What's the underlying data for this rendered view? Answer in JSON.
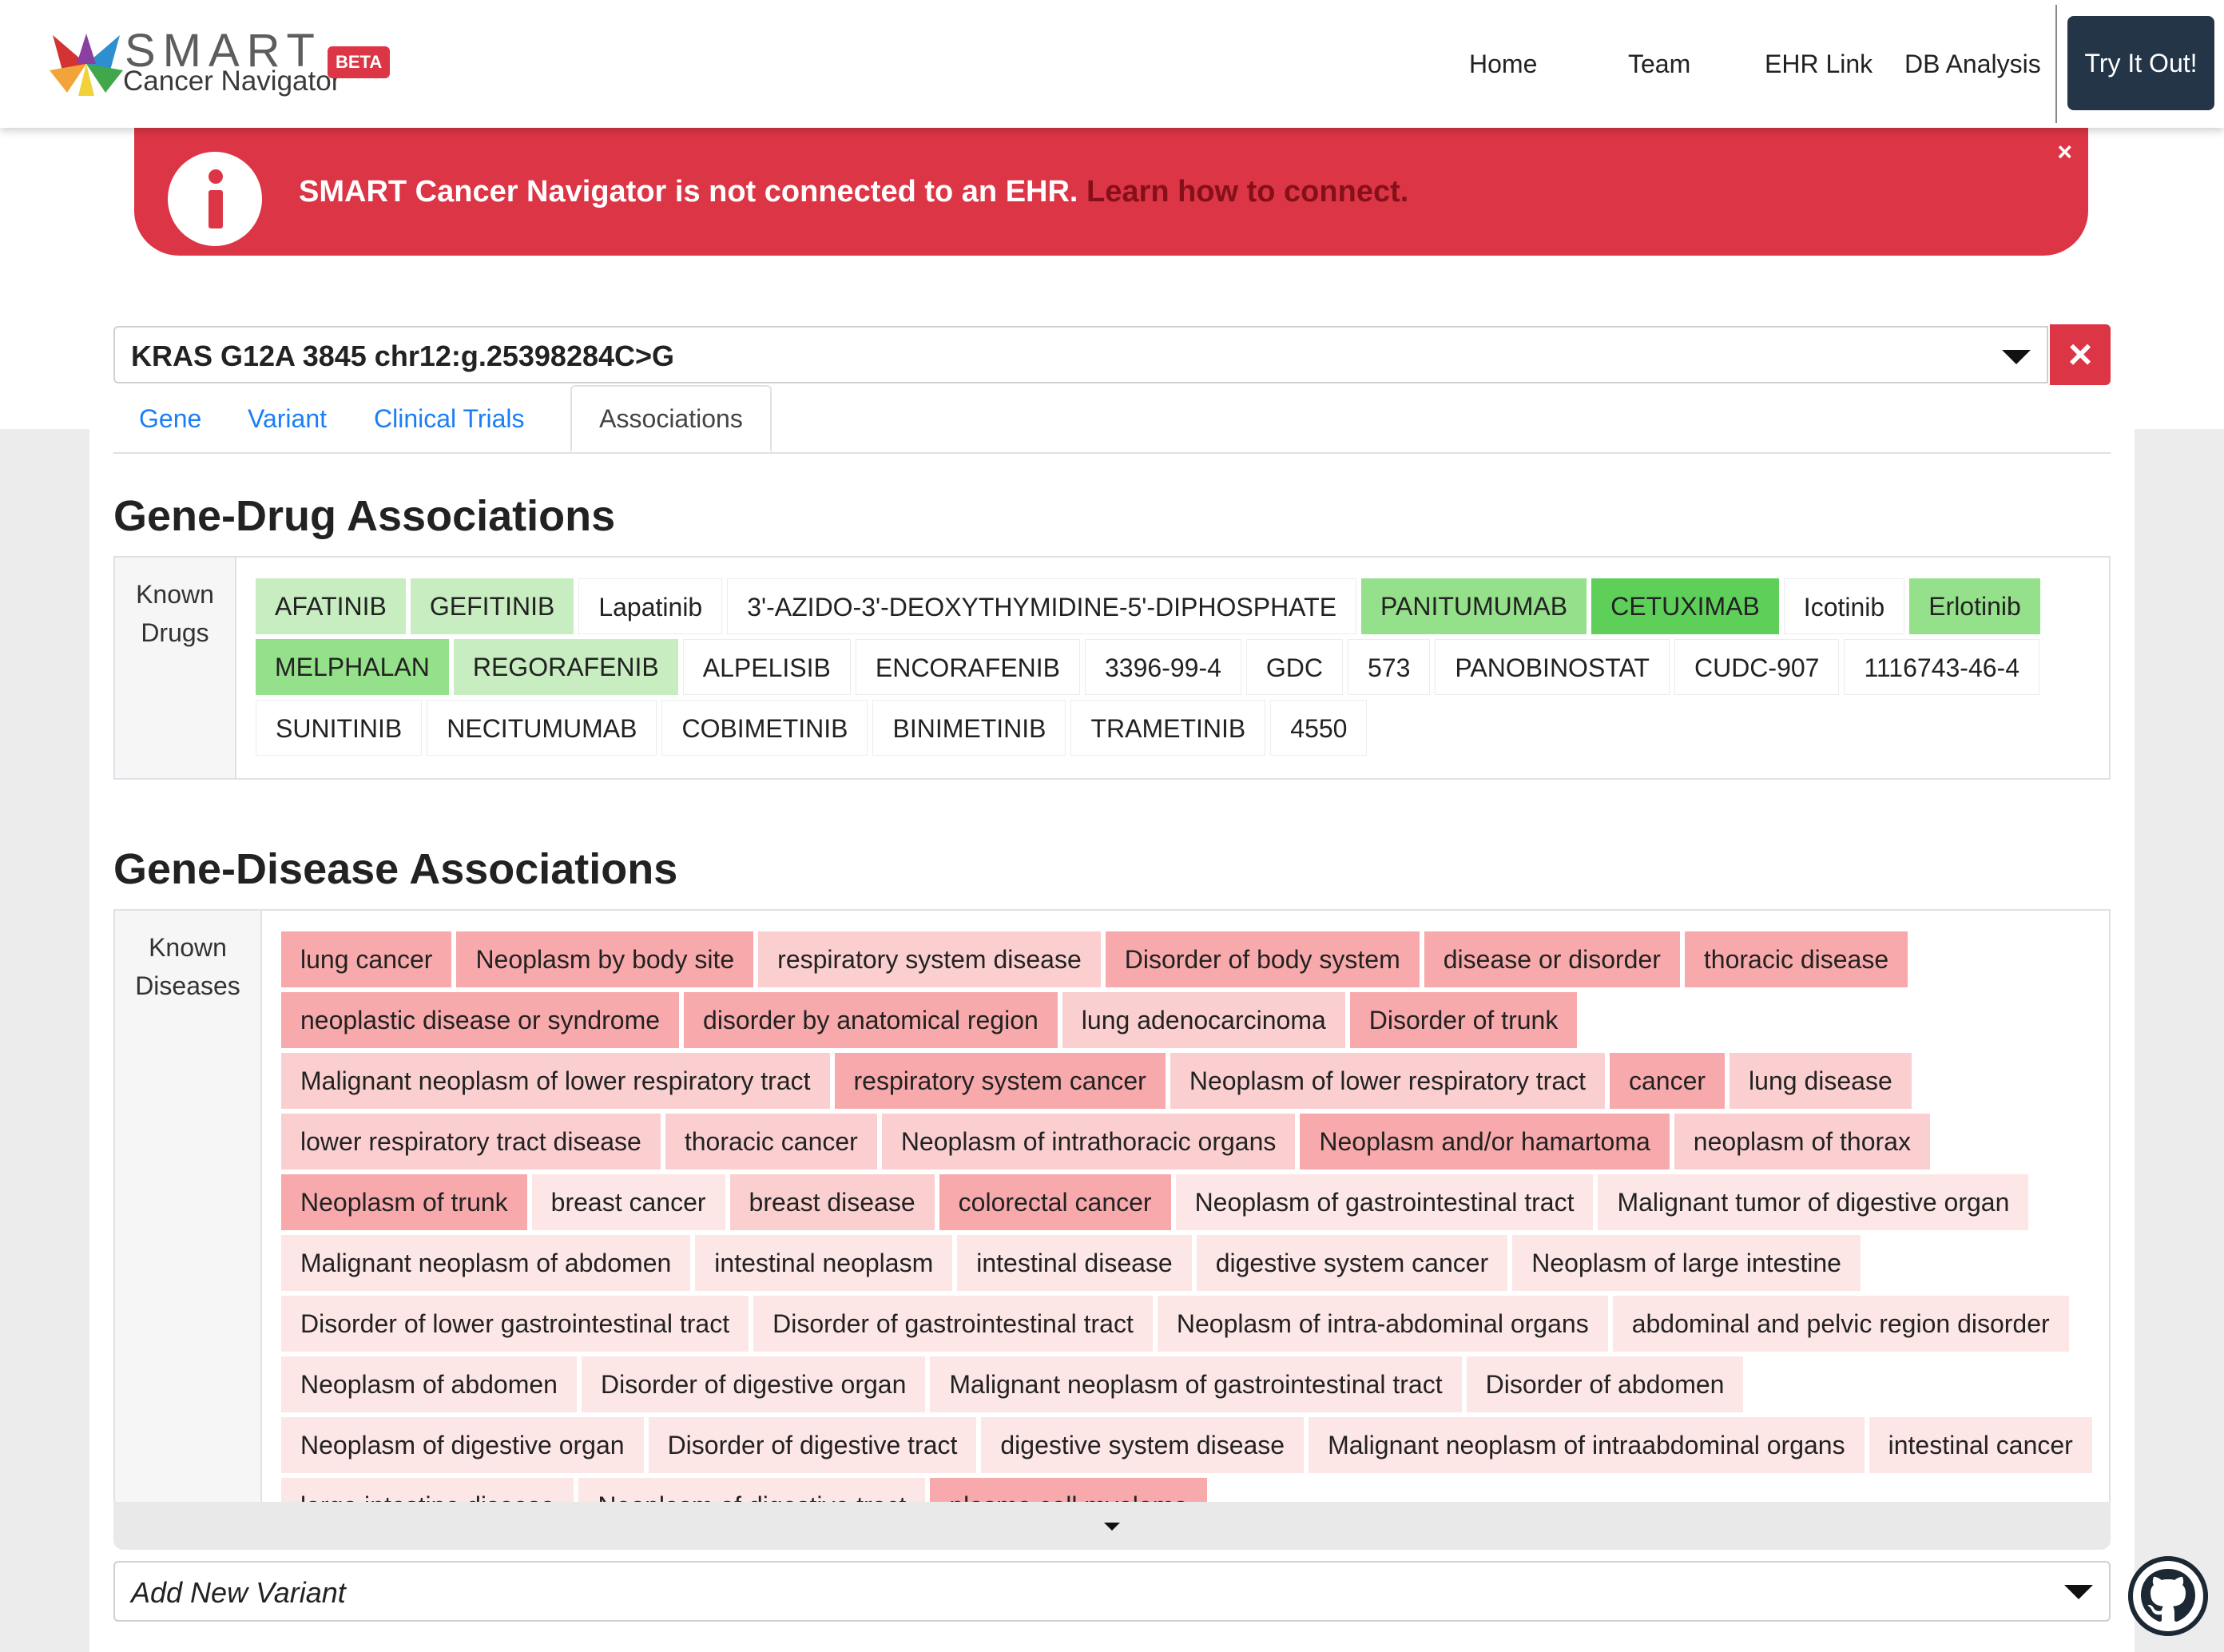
{
  "brand": {
    "name": "SMART",
    "subtitle": "Cancer Navigator",
    "badge": "BETA"
  },
  "nav": {
    "links": [
      "Home",
      "Team",
      "EHR Link",
      "DB Analysis"
    ],
    "cta": "Try It Out!"
  },
  "alert": {
    "message": "SMART Cancer Navigator is not connected to an EHR.",
    "link": "Learn how to connect.",
    "close": "×"
  },
  "variant": {
    "selected": "KRAS G12A 3845 chr12:g.25398284C>G",
    "clear": "×"
  },
  "tabs": [
    "Gene",
    "Variant",
    "Clinical Trials",
    "Associations"
  ],
  "active_tab": "Associations",
  "drug_section": {
    "title": "Gene-Drug Associations",
    "label_line1": "Known",
    "label_line2": "Drugs",
    "drugs": [
      {
        "name": "AFATINIB",
        "level": 1
      },
      {
        "name": "GEFITINIB",
        "level": 1
      },
      {
        "name": "Lapatinib",
        "level": 0
      },
      {
        "name": "3'-AZIDO-3'-DEOXYTHYMIDINE-5'-DIPHOSPHATE",
        "level": 0
      },
      {
        "name": "PANITUMUMAB",
        "level": 2
      },
      {
        "name": "CETUXIMAB",
        "level": 3
      },
      {
        "name": "Icotinib",
        "level": 0
      },
      {
        "name": "Erlotinib",
        "level": 2
      },
      {
        "name": "MELPHALAN",
        "level": 2
      },
      {
        "name": "REGORAFENIB",
        "level": 1
      },
      {
        "name": "ALPELISIB",
        "level": 0
      },
      {
        "name": "ENCORAFENIB",
        "level": 0
      },
      {
        "name": "3396-99-4",
        "level": 0
      },
      {
        "name": "GDC",
        "level": 0
      },
      {
        "name": "573",
        "level": 0
      },
      {
        "name": "PANOBINOSTAT",
        "level": 0
      },
      {
        "name": "CUDC-907",
        "level": 0
      },
      {
        "name": "1116743-46-4",
        "level": 0
      },
      {
        "name": "SUNITINIB",
        "level": 0
      },
      {
        "name": "NECITUMUMAB",
        "level": 0
      },
      {
        "name": "COBIMETINIB",
        "level": 0
      },
      {
        "name": "BINIMETINIB",
        "level": 0
      },
      {
        "name": "TRAMETINIB",
        "level": 0
      },
      {
        "name": "4550",
        "level": 0
      }
    ]
  },
  "disease_section": {
    "title": "Gene-Disease Associations",
    "label_line1": "Known",
    "label_line2": "Diseases",
    "diseases": [
      {
        "name": "lung cancer",
        "level": 3
      },
      {
        "name": "Neoplasm by body site",
        "level": 3
      },
      {
        "name": "respiratory system disease",
        "level": 2
      },
      {
        "name": "Disorder of body system",
        "level": 3
      },
      {
        "name": "disease or disorder",
        "level": 3
      },
      {
        "name": "thoracic disease",
        "level": 3
      },
      {
        "name": "neoplastic disease or syndrome",
        "level": 3
      },
      {
        "name": "disorder by anatomical region",
        "level": 3
      },
      {
        "name": "lung adenocarcinoma",
        "level": 2
      },
      {
        "name": "Disorder of trunk",
        "level": 3
      },
      {
        "name": "Malignant neoplasm of lower respiratory tract",
        "level": 2
      },
      {
        "name": "respiratory system cancer",
        "level": 3
      },
      {
        "name": "Neoplasm of lower respiratory tract",
        "level": 2
      },
      {
        "name": "cancer",
        "level": 3
      },
      {
        "name": "lung disease",
        "level": 2
      },
      {
        "name": "lower respiratory tract disease",
        "level": 2
      },
      {
        "name": "thoracic cancer",
        "level": 2
      },
      {
        "name": "Neoplasm of intrathoracic organs",
        "level": 2
      },
      {
        "name": "Neoplasm and/or hamartoma",
        "level": 3
      },
      {
        "name": "neoplasm of thorax",
        "level": 2
      },
      {
        "name": "Neoplasm of trunk",
        "level": 3
      },
      {
        "name": "breast cancer",
        "level": 1
      },
      {
        "name": "breast disease",
        "level": 2
      },
      {
        "name": "colorectal cancer",
        "level": 3
      },
      {
        "name": "Neoplasm of gastrointestinal tract",
        "level": 1
      },
      {
        "name": "Malignant tumor of digestive organ",
        "level": 1
      },
      {
        "name": "Malignant neoplasm of abdomen",
        "level": 1
      },
      {
        "name": "intestinal neoplasm",
        "level": 1
      },
      {
        "name": "intestinal disease",
        "level": 1
      },
      {
        "name": "digestive system cancer",
        "level": 1
      },
      {
        "name": "Neoplasm of large intestine",
        "level": 1
      },
      {
        "name": "Disorder of lower gastrointestinal tract",
        "level": 1
      },
      {
        "name": "Disorder of gastrointestinal tract",
        "level": 1
      },
      {
        "name": "Neoplasm of intra-abdominal organs",
        "level": 1
      },
      {
        "name": "abdominal and pelvic region disorder",
        "level": 1
      },
      {
        "name": "Neoplasm of abdomen",
        "level": 1
      },
      {
        "name": "Disorder of digestive organ",
        "level": 1
      },
      {
        "name": "Malignant neoplasm of gastrointestinal tract",
        "level": 1
      },
      {
        "name": "Disorder of abdomen",
        "level": 1
      },
      {
        "name": "Neoplasm of digestive organ",
        "level": 1
      },
      {
        "name": "Disorder of digestive tract",
        "level": 1
      },
      {
        "name": "digestive system disease",
        "level": 1
      },
      {
        "name": "Malignant neoplasm of intraabdominal organs",
        "level": 1
      },
      {
        "name": "intestinal cancer",
        "level": 1
      },
      {
        "name": "large intestine disease",
        "level": 1
      },
      {
        "name": "Neoplasm of digestive tract",
        "level": 1
      },
      {
        "name": "plasma cell myeloma",
        "level": 3
      }
    ]
  },
  "add_variant": {
    "placeholder": "Add New Variant"
  },
  "colors": {
    "danger": "#dc3545",
    "primary_link": "#1a7ef7",
    "nav_cta": "#243548",
    "drug_levels": [
      "#ffffff",
      "#c7edc0",
      "#95e08a",
      "#5ed05a"
    ],
    "disease_levels": [
      "#ffffff",
      "#fde6e6",
      "#fbcfd0",
      "#f8a9ab"
    ]
  },
  "icons": [
    "smart-logo-icon",
    "info-icon",
    "close-icon",
    "caret-down-icon",
    "github-icon"
  ]
}
